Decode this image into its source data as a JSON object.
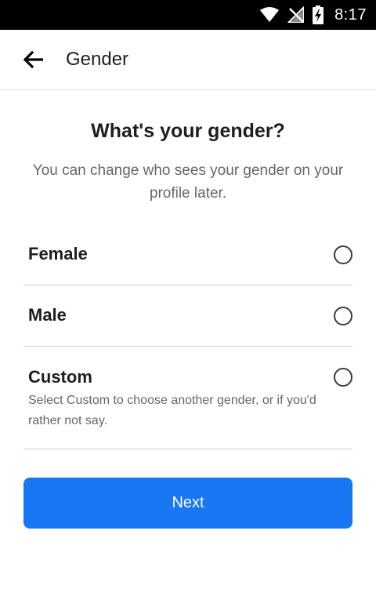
{
  "status_bar": {
    "time": "8:17",
    "icons": [
      "wifi-icon",
      "no-signal-icon",
      "battery-charging-icon"
    ]
  },
  "app_bar": {
    "back_icon": "back-arrow-icon",
    "title": "Gender"
  },
  "main": {
    "heading": "What's your gender?",
    "subheading": "You can change who sees your gender on your profile later.",
    "options": [
      {
        "label": "Female",
        "description": "",
        "selected": false
      },
      {
        "label": "Male",
        "description": "",
        "selected": false
      },
      {
        "label": "Custom",
        "description": "Select Custom to choose another gender, or if you'd rather not say.",
        "selected": false
      }
    ],
    "next_label": "Next"
  },
  "colors": {
    "accent": "#1877f2",
    "status_bar": "#000000",
    "text_primary": "#1c1e21",
    "text_secondary": "#65676b"
  }
}
